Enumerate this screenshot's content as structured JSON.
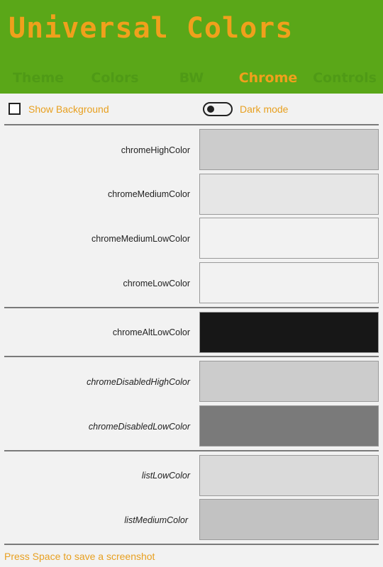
{
  "header": {
    "title": "Universal Colors",
    "tabs": [
      {
        "label": "Theme",
        "active": false
      },
      {
        "label": "Colors",
        "active": false
      },
      {
        "label": "BW",
        "active": false
      },
      {
        "label": "Chrome",
        "active": true
      },
      {
        "label": "Controls",
        "active": false
      }
    ],
    "background_color": "#5aa718",
    "accent_color": "#f0a01c"
  },
  "options": {
    "show_background_label": "Show Background",
    "show_background_checked": false,
    "dark_mode_label": "Dark mode",
    "dark_mode_on": false
  },
  "rows": [
    {
      "label": "chromeHighColor",
      "color": "#cccccc",
      "italic": false
    },
    {
      "label": "chromeMediumColor",
      "color": "#e6e6e6",
      "italic": false
    },
    {
      "label": "chromeMediumLowColor",
      "color": "#f2f2f2",
      "italic": false
    },
    {
      "label": "chromeLowColor",
      "color": "#f2f2f2",
      "italic": false
    },
    {
      "label": "chromeAltLowColor",
      "color": "#171717",
      "italic": false
    },
    {
      "label": "chromeDisabledHighColor",
      "color": "#cccccc",
      "italic": true
    },
    {
      "label": "chromeDisabledLowColor",
      "color": "#7a7a7a",
      "italic": true
    },
    {
      "label": "listLowColor",
      "color": "#dadada",
      "italic": true
    },
    {
      "label": "listMediumColor",
      "color": "#c2c2c2",
      "italic": true
    }
  ],
  "footer": {
    "hint": "Press Space to save a screenshot"
  }
}
